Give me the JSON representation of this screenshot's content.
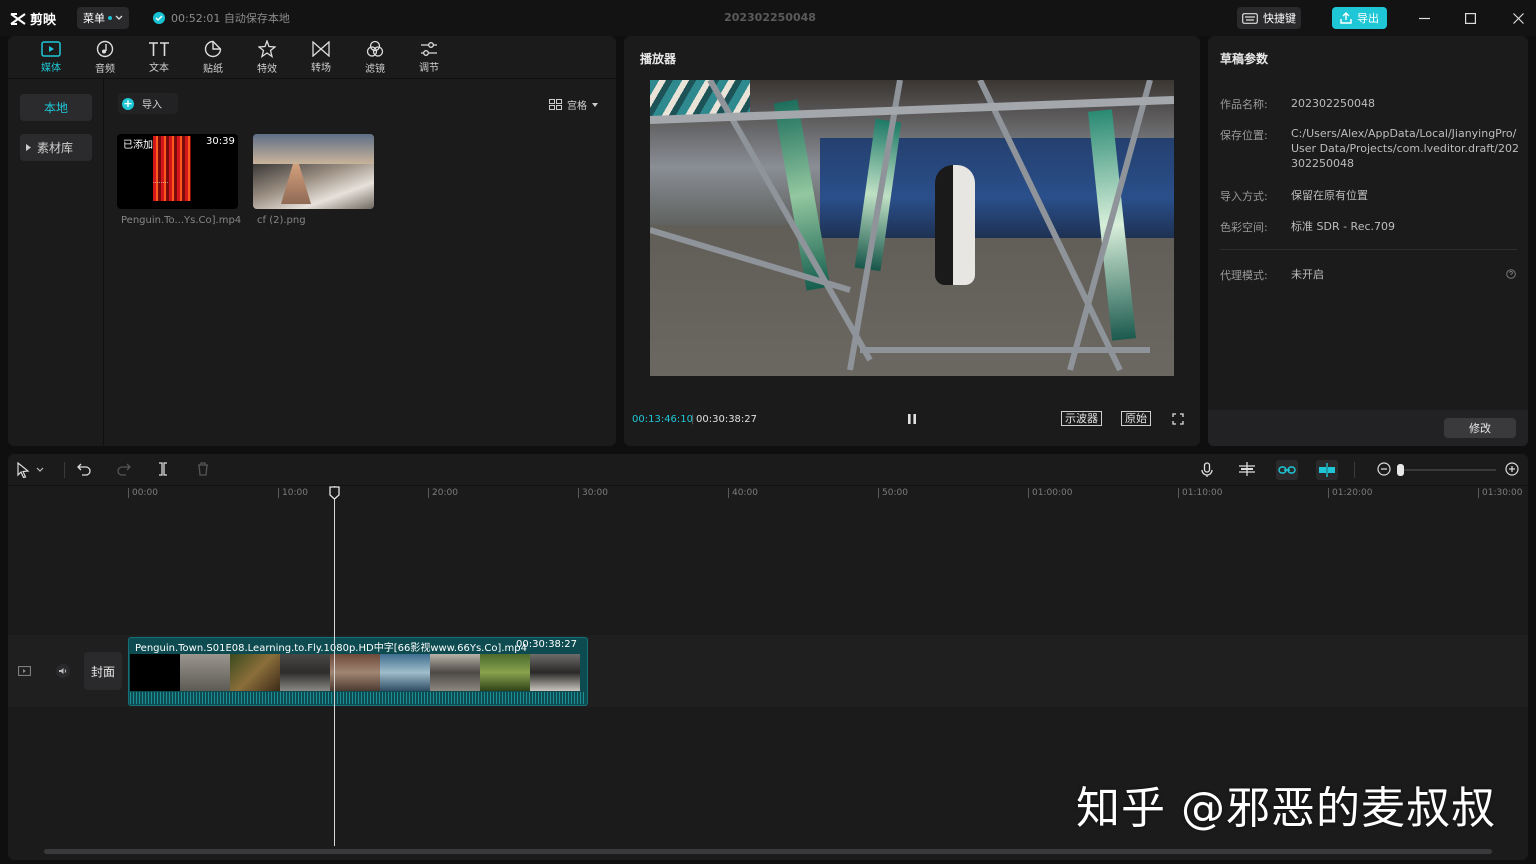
{
  "app": {
    "logo_text": "剪映",
    "menu_label": "菜单",
    "autosave_text": "00:52:01 自动保存本地",
    "project_title": "202302250048",
    "shortcut_label": "快捷键",
    "export_label": "导出",
    "accent_color": "#1fc7d6"
  },
  "media": {
    "tabs": [
      {
        "label": "媒体",
        "icon": "media-icon",
        "active": true
      },
      {
        "label": "音频",
        "icon": "audio-icon"
      },
      {
        "label": "文本",
        "icon": "text-icon"
      },
      {
        "label": "贴纸",
        "icon": "sticker-icon"
      },
      {
        "label": "特效",
        "icon": "effects-icon"
      },
      {
        "label": "转场",
        "icon": "transition-icon"
      },
      {
        "label": "滤镜",
        "icon": "filter-icon"
      },
      {
        "label": "调节",
        "icon": "adjust-icon"
      }
    ],
    "nav": {
      "local": "本地",
      "library": "素材库"
    },
    "import_label": "导入",
    "view_label": "宫格",
    "items": [
      {
        "badge": "已添加",
        "duration": "30:39",
        "filename": "Penguin.To...Ys.Co].mp4"
      },
      {
        "filename": "cf (2).png"
      }
    ]
  },
  "player": {
    "title": "播放器",
    "time_current": "00:13:46:10",
    "time_total": "00:30:38:27",
    "waveform_label": "示波器",
    "original_label": "原始"
  },
  "draft": {
    "title": "草稿参数",
    "fields": [
      {
        "label": "作品名称:",
        "value": "202302250048"
      },
      {
        "label": "保存位置:",
        "value": "C:/Users/Alex/AppData/Local/JianyingPro/User Data/Projects/com.lveditor.draft/202302250048"
      },
      {
        "label": "导入方式:",
        "value": "保留在原有位置"
      },
      {
        "label": "色彩空间:",
        "value": "标准 SDR - Rec.709"
      },
      {
        "label": "代理模式:",
        "value": "未开启"
      }
    ],
    "modify_label": "修改"
  },
  "timeline": {
    "ticks": [
      "00:00",
      "10:00",
      "20:00",
      "30:00",
      "40:00",
      "50:00",
      "01:00:00",
      "01:10:00",
      "01:20:00",
      "01:30:00"
    ],
    "cover_label": "封面",
    "clip": {
      "name": "Penguin.Town.S01E08.Learning.to.Fly.1080p.HD中字[66影视www.66Ys.Co].mp4",
      "duration": "00:30:38:27"
    }
  },
  "watermark": "知乎 @邪恶的麦叔叔"
}
